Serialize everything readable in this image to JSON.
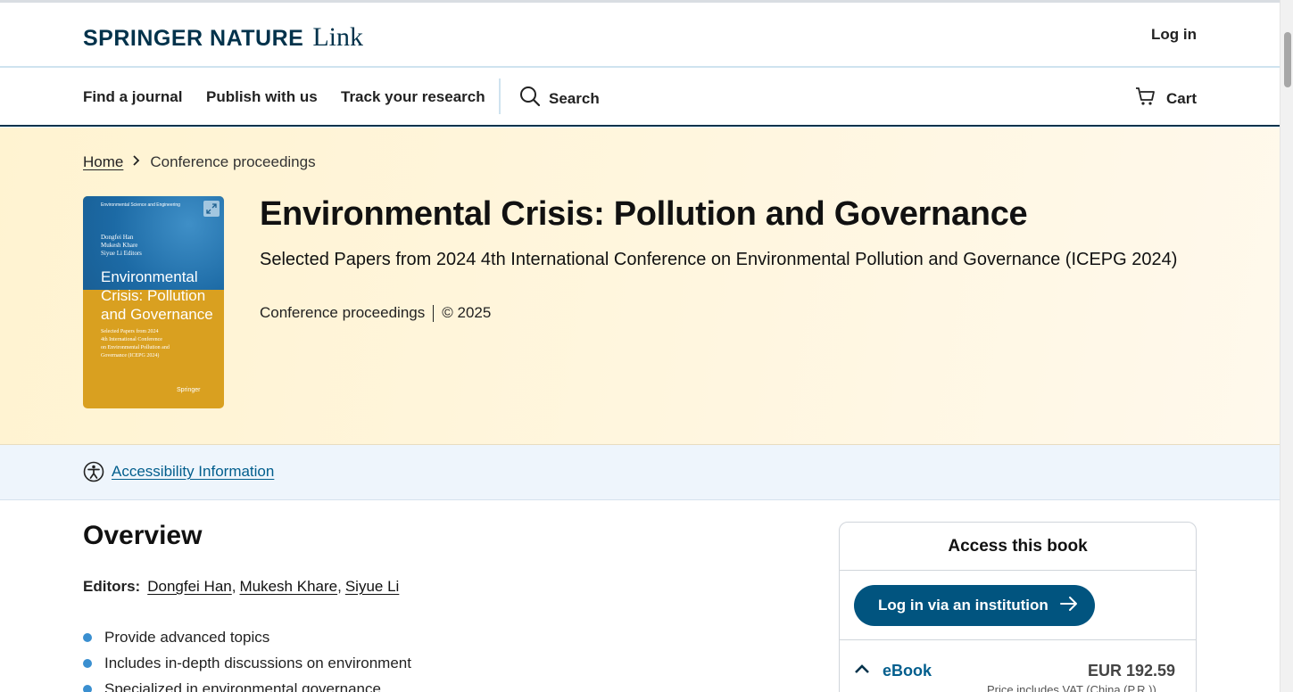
{
  "header": {
    "logo_main": "SPRINGER NATURE",
    "logo_link": "Link",
    "login_label": "Log in"
  },
  "nav": {
    "items": [
      "Find a journal",
      "Publish with us",
      "Track your research"
    ],
    "search_label": "Search",
    "cart_label": "Cart"
  },
  "breadcrumb": {
    "home": "Home",
    "current": "Conference proceedings"
  },
  "cover": {
    "series": "Environmental Science and Engineering",
    "editors": [
      "Dongfei Han",
      "Mukesh Khare",
      "Siyue Li  Editors"
    ],
    "title_lines": [
      "Environmental",
      "Crisis: Pollution",
      "and Governance"
    ],
    "subtitle_lines": [
      "Selected Papers from 2024",
      "4th International Conference",
      "on Environmental Pollution and",
      "Governance (ICEPG 2024)"
    ],
    "publisher": "Springer"
  },
  "book": {
    "title": "Environmental Crisis: Pollution and Governance",
    "subtitle": "Selected Papers from 2024 4th International Conference on Environmental Pollution and Governance (ICEPG 2024)",
    "type": "Conference proceedings",
    "copyright": "© 2025"
  },
  "accessibility": {
    "link_label": "Accessibility Information"
  },
  "overview": {
    "heading": "Overview",
    "editors_label": "Editors:",
    "editors": [
      "Dongfei Han",
      "Mukesh Khare",
      "Siyue Li"
    ],
    "bullets": [
      "Provide advanced topics",
      "Includes in-depth discussions on environment",
      "Specialized in environmental governance"
    ]
  },
  "access_panel": {
    "title": "Access this book",
    "institution_button": "Log in via an institution",
    "ebook_label": "eBook",
    "ebook_price": "EUR 192.59",
    "vat_note": "Price includes VAT (China (P.R.))"
  },
  "colors": {
    "brand_navy": "#01324b",
    "link_blue": "#025e8d",
    "button_blue": "#01547f",
    "hero_bg": "#fff3d1",
    "bullet_blue": "#3a8fd0"
  }
}
